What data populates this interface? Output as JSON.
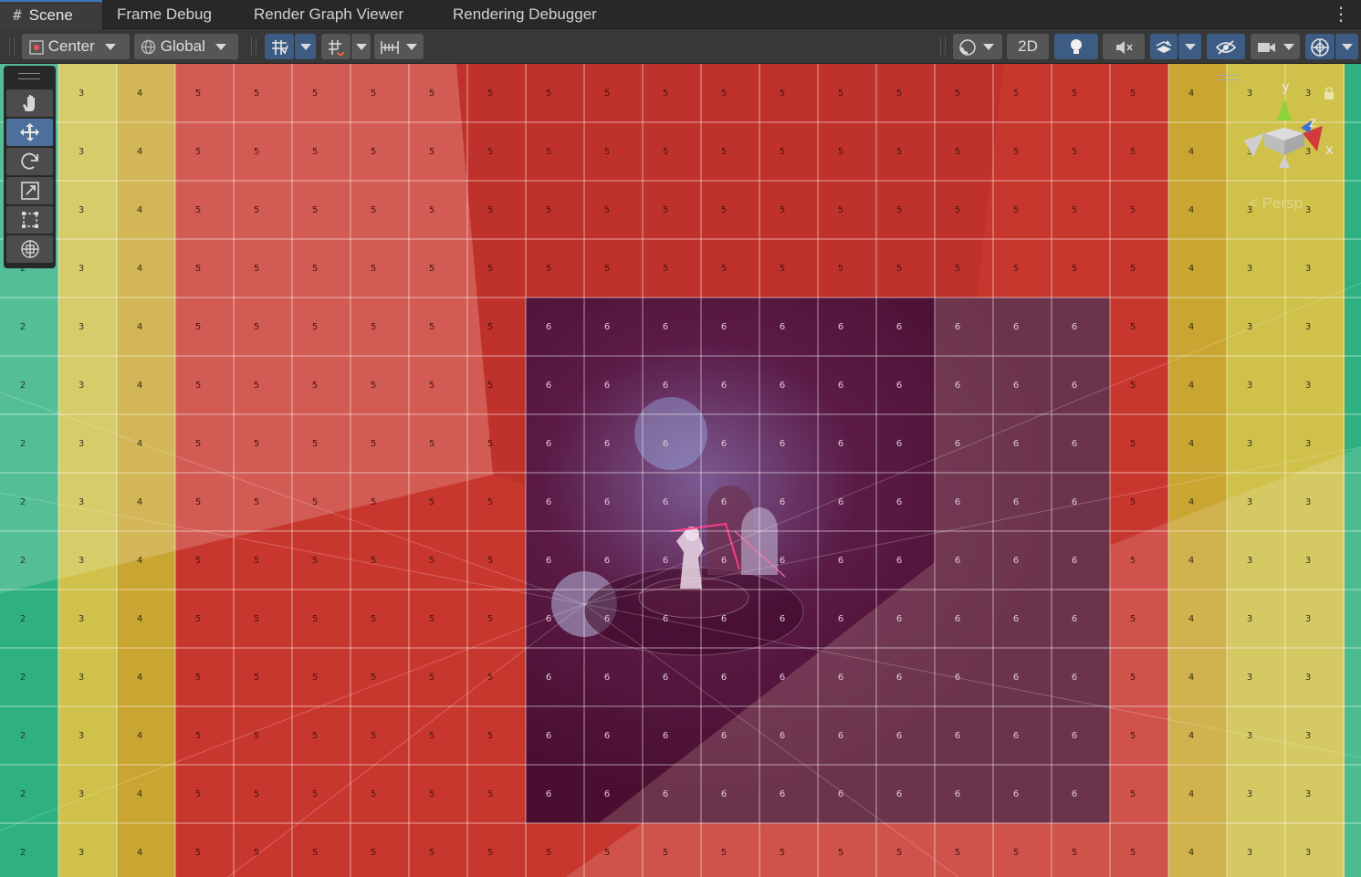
{
  "tabs": [
    {
      "label": "Scene",
      "icon": "hash-icon",
      "active": true
    },
    {
      "label": "Frame Debug",
      "active": false
    },
    {
      "label": "Render Graph Viewer",
      "active": false
    },
    {
      "label": "Rendering Debugger",
      "active": false
    }
  ],
  "menu_icon": "kebab-menu-icon",
  "toolbar": {
    "pivot_label": "Center",
    "space_label": "Global",
    "mode_2d_label": "2D",
    "icons": [
      "pivot-icon",
      "globe-icon",
      "grid-snap-icon",
      "increment-snap-icon",
      "ruler-snap-icon",
      "shading-mode-icon",
      "lighting-icon",
      "audio-mute-icon",
      "effects-icon",
      "visibility-icon",
      "camera-icon",
      "gizmos-icon"
    ]
  },
  "tools": [
    "hand-tool-icon",
    "move-tool-icon",
    "rotate-tool-icon",
    "scale-tool-icon",
    "rect-tool-icon",
    "transform-tool-icon"
  ],
  "gizmo": {
    "y_label": "y",
    "z_label": "z",
    "x_label": "x",
    "projection_label": "< Persp"
  },
  "overlay_grid": {
    "column_values": [
      2,
      3,
      4,
      5,
      5,
      5,
      5,
      5,
      5,
      5,
      5,
      5,
      5,
      5,
      5,
      5,
      5,
      5,
      5,
      5,
      4,
      3,
      3
    ],
    "inner_region_value": 6,
    "inner_region": {
      "col_start": 9,
      "col_end": 18,
      "row_start": 4,
      "row_end": 12
    },
    "rows": 14,
    "colors": {
      "green": "#2fb080",
      "yellow": "#cfc14a",
      "gold": "#c9a632",
      "red": "#c8372e",
      "purple": "#5a1430",
      "wall_dark": "#7a3848"
    }
  }
}
